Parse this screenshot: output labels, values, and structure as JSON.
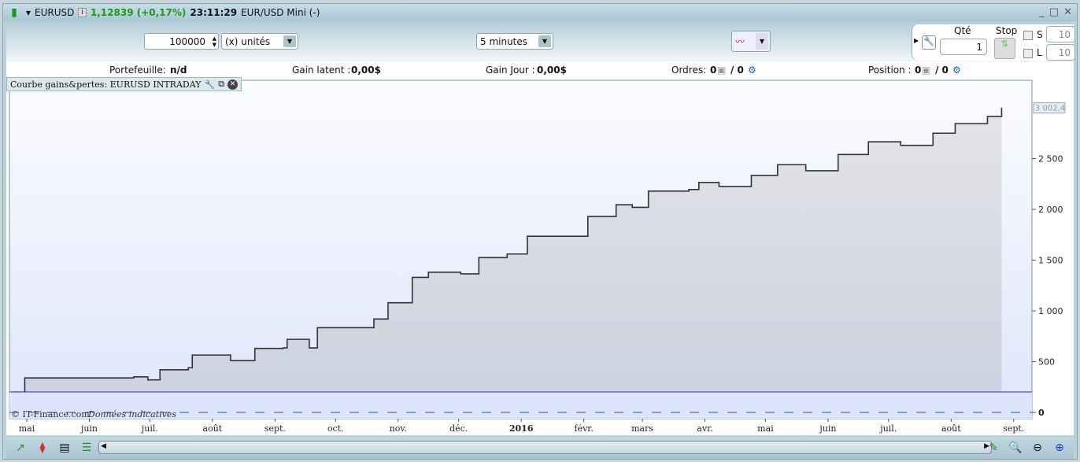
{
  "title": {
    "symbol": "EURUSD",
    "price": "1,12839 (+0,17%)",
    "time": "23:11:29",
    "instrument": "EUR/USD Mini (-)"
  },
  "toolbar": {
    "quantity": "100000",
    "unit": "(x) unités",
    "timeframe": "5 minutes",
    "qte_label": "Qté",
    "qte_value": "1",
    "stop_label": "Stop",
    "s_label": "S",
    "s_value": "10",
    "l_label": "L",
    "l_value": "10"
  },
  "info": {
    "portfolio_label": "Portefeuille:",
    "portfolio_value": "n/d",
    "latent_label": "Gain latent :",
    "latent_value": "0,00$",
    "day_label": "Gain Jour :",
    "day_value": "0,00$",
    "orders_label": "Ordres:",
    "orders_a": "0",
    "orders_b": "/ 0",
    "position_label": "Position :",
    "position_a": "0",
    "position_b": "/ 0"
  },
  "panel": {
    "title": "Courbe gains&pertes: EURUSD INTRADAY"
  },
  "copyright": "© IT-Finance.com",
  "disclaimer": "Données indicatives",
  "colors": {
    "price_up": "#1a9a1a",
    "line": "#333333",
    "fill": "#d0d4dc",
    "separator": "#3030c0"
  },
  "chart_data": {
    "type": "line",
    "current_value_label": "3 002,4",
    "yticks": [
      {
        "v": 0,
        "l": "0"
      },
      {
        "v": 500,
        "l": "500"
      },
      {
        "v": 1000,
        "l": "1 000"
      },
      {
        "v": 1500,
        "l": "1 500"
      },
      {
        "v": 2000,
        "l": "2 000"
      },
      {
        "v": 2500,
        "l": "2 500"
      }
    ],
    "xticks": [
      {
        "d": "2015-05-01",
        "l": "mai"
      },
      {
        "d": "2015-06-01",
        "l": "juin"
      },
      {
        "d": "2015-07-01",
        "l": "juil."
      },
      {
        "d": "2015-08-01",
        "l": "août"
      },
      {
        "d": "2015-09-01",
        "l": "sept."
      },
      {
        "d": "2015-10-01",
        "l": "oct."
      },
      {
        "d": "2015-11-01",
        "l": "nov."
      },
      {
        "d": "2015-12-01",
        "l": "déc."
      },
      {
        "d": "2016-01-01",
        "l": "2016"
      },
      {
        "d": "2016-02-01",
        "l": "févr."
      },
      {
        "d": "2016-03-01",
        "l": "mars"
      },
      {
        "d": "2016-04-01",
        "l": "avr."
      },
      {
        "d": "2016-05-01",
        "l": "mai"
      },
      {
        "d": "2016-06-01",
        "l": "juin"
      },
      {
        "d": "2016-07-01",
        "l": "juil."
      },
      {
        "d": "2016-08-01",
        "l": "août"
      },
      {
        "d": "2016-09-01",
        "l": "sept."
      }
    ],
    "points": [
      [
        "2015-04-24",
        200
      ],
      [
        "2015-04-30",
        340
      ],
      [
        "2015-06-23",
        350
      ],
      [
        "2015-06-30",
        320
      ],
      [
        "2015-07-06",
        420
      ],
      [
        "2015-07-20",
        440
      ],
      [
        "2015-07-22",
        565
      ],
      [
        "2015-08-10",
        510
      ],
      [
        "2015-08-22",
        630
      ],
      [
        "2015-09-05",
        635
      ],
      [
        "2015-09-07",
        720
      ],
      [
        "2015-09-18",
        635
      ],
      [
        "2015-09-22",
        835
      ],
      [
        "2015-10-16",
        835
      ],
      [
        "2015-10-20",
        920
      ],
      [
        "2015-10-27",
        1080
      ],
      [
        "2015-11-08",
        1330
      ],
      [
        "2015-11-16",
        1380
      ],
      [
        "2015-12-02",
        1365
      ],
      [
        "2015-12-11",
        1525
      ],
      [
        "2015-12-25",
        1560
      ],
      [
        "2016-01-04",
        1735
      ],
      [
        "2016-01-31",
        1735
      ],
      [
        "2016-02-03",
        1930
      ],
      [
        "2016-02-17",
        2045
      ],
      [
        "2016-02-25",
        2020
      ],
      [
        "2016-03-04",
        2180
      ],
      [
        "2016-03-24",
        2195
      ],
      [
        "2016-03-29",
        2265
      ],
      [
        "2016-04-08",
        2225
      ],
      [
        "2016-04-24",
        2335
      ],
      [
        "2016-05-07",
        2440
      ],
      [
        "2016-05-21",
        2380
      ],
      [
        "2016-06-06",
        2540
      ],
      [
        "2016-06-21",
        2665
      ],
      [
        "2016-07-07",
        2630
      ],
      [
        "2016-07-23",
        2750
      ],
      [
        "2016-08-03",
        2845
      ],
      [
        "2016-08-19",
        2915
      ],
      [
        "2016-08-26",
        3002.4
      ]
    ]
  }
}
